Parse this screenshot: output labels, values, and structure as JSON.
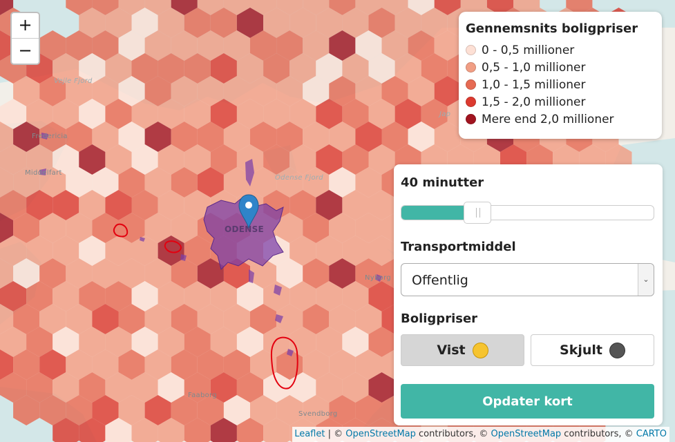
{
  "map": {
    "place_labels": [
      "Vejle Fjord",
      "Fredericia",
      "Middelfart",
      "Odense Fjord",
      "ODENSE",
      "Nyborg",
      "Faaborg",
      "Svendborg",
      "Jap"
    ],
    "colors": {
      "water": "#d3e7e8",
      "land": "#f2efe9",
      "isochrone": "#7a3fa8",
      "marker": "#2f84c9",
      "red_outline": "#e3000f"
    }
  },
  "zoom": {
    "in_label": "+",
    "out_label": "−"
  },
  "legend": {
    "title": "Gennemsnits boligpriser",
    "items": [
      {
        "label": "0 - 0,5 millioner",
        "color": "#fde0d5"
      },
      {
        "label": "0,5 - 1,0 millioner",
        "color": "#f19e84"
      },
      {
        "label": "1,0 - 1,5 millioner",
        "color": "#e66a53"
      },
      {
        "label": "1,5 - 2,0 millioner",
        "color": "#dc3a2f"
      },
      {
        "label": "Mere end 2,0 millioner",
        "color": "#a11420"
      }
    ]
  },
  "controls": {
    "time_label": "40 minutter",
    "slider_value_fraction": 0.28,
    "transport_label": "Transportmiddel",
    "transport_selected": "Offentlig",
    "prices_label": "Boligpriser",
    "show_button": "Vist",
    "hide_button": "Skjult",
    "update_button": "Opdater kort",
    "accent_color": "#41b6a6"
  },
  "attribution": {
    "leaflet": "Leaflet",
    "sep1": " | © ",
    "osm1": "OpenStreetMap",
    "mid": " contributors, © ",
    "osm2": "OpenStreetMap",
    "mid2": " contributors, © ",
    "carto": "CARTO"
  }
}
